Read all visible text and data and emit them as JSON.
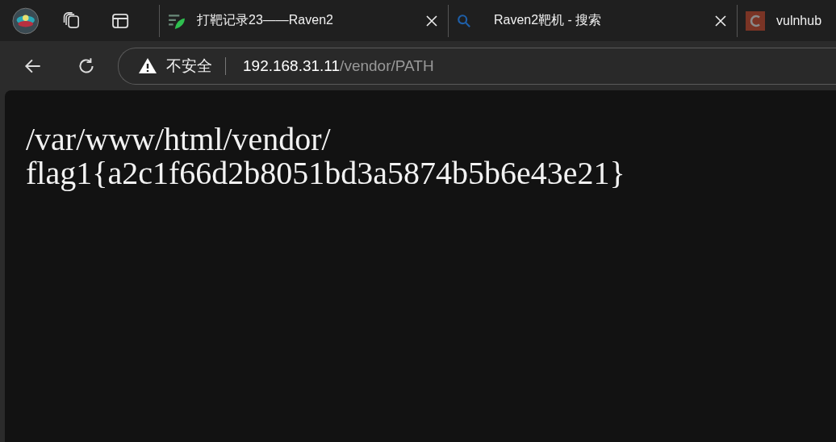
{
  "tabs": [
    {
      "title": "打靶记录23——Raven2",
      "kind": "leaf",
      "selected": false
    },
    {
      "title": "Raven2靶机 - 搜索",
      "kind": "search",
      "selected": false
    },
    {
      "title": "vulnhub",
      "kind": "logo",
      "selected": false
    }
  ],
  "address_bar": {
    "security": "不安全",
    "host": "192.168.31.11",
    "path": "/vendor/PATH"
  },
  "page": {
    "lines": [
      "/var/www/html/vendor/",
      "flag1{a2c1f66d2b8051bd3a5874b5b6e43e21}"
    ]
  }
}
